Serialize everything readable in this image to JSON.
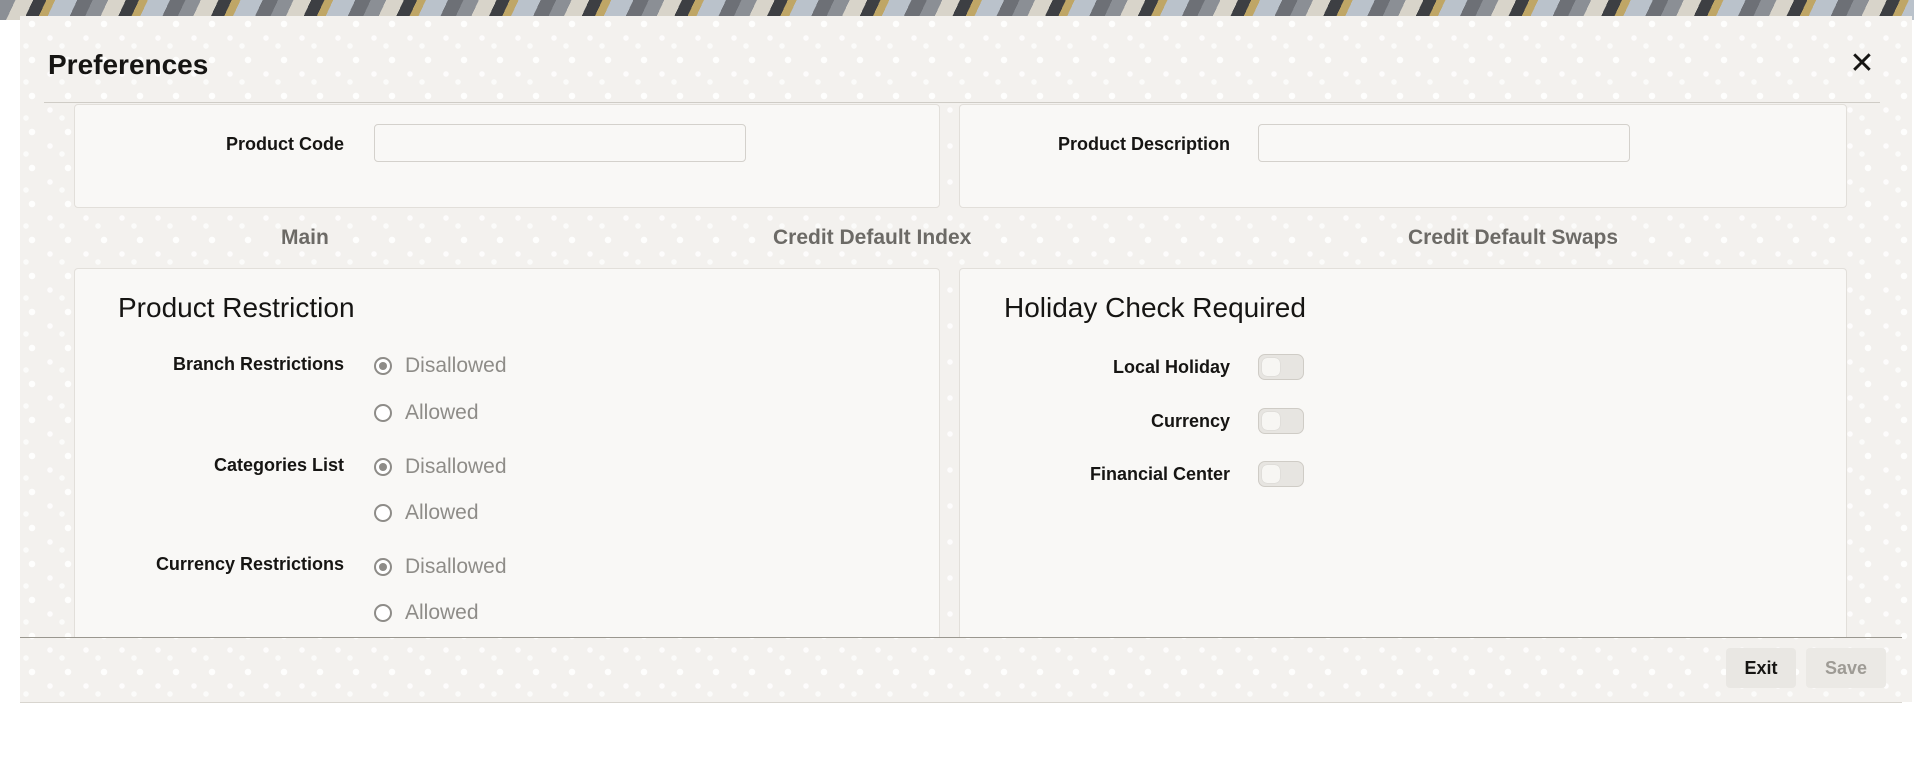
{
  "dialog": {
    "title": "Preferences",
    "close_icon": "close-icon"
  },
  "header_fields": {
    "product_code_label": "Product Code",
    "product_code_value": "",
    "product_description_label": "Product Description",
    "product_description_value": ""
  },
  "tabs": [
    {
      "label": "Main"
    },
    {
      "label": "Credit Default Index"
    },
    {
      "label": "Credit Default Swaps"
    }
  ],
  "product_restriction": {
    "title": "Product Restriction",
    "groups": [
      {
        "label": "Branch Restrictions",
        "options": [
          "Disallowed",
          "Allowed"
        ],
        "selected": "Disallowed"
      },
      {
        "label": "Categories List",
        "options": [
          "Disallowed",
          "Allowed"
        ],
        "selected": "Disallowed"
      },
      {
        "label": "Currency Restrictions",
        "options": [
          "Disallowed",
          "Allowed"
        ],
        "selected": "Disallowed"
      }
    ]
  },
  "holiday_check": {
    "title": "Holiday Check Required",
    "toggles": [
      {
        "label": "Local Holiday",
        "on": false
      },
      {
        "label": "Currency",
        "on": false
      },
      {
        "label": "Financial Center",
        "on": false
      }
    ]
  },
  "footer": {
    "exit_label": "Exit",
    "save_label": "Save"
  }
}
